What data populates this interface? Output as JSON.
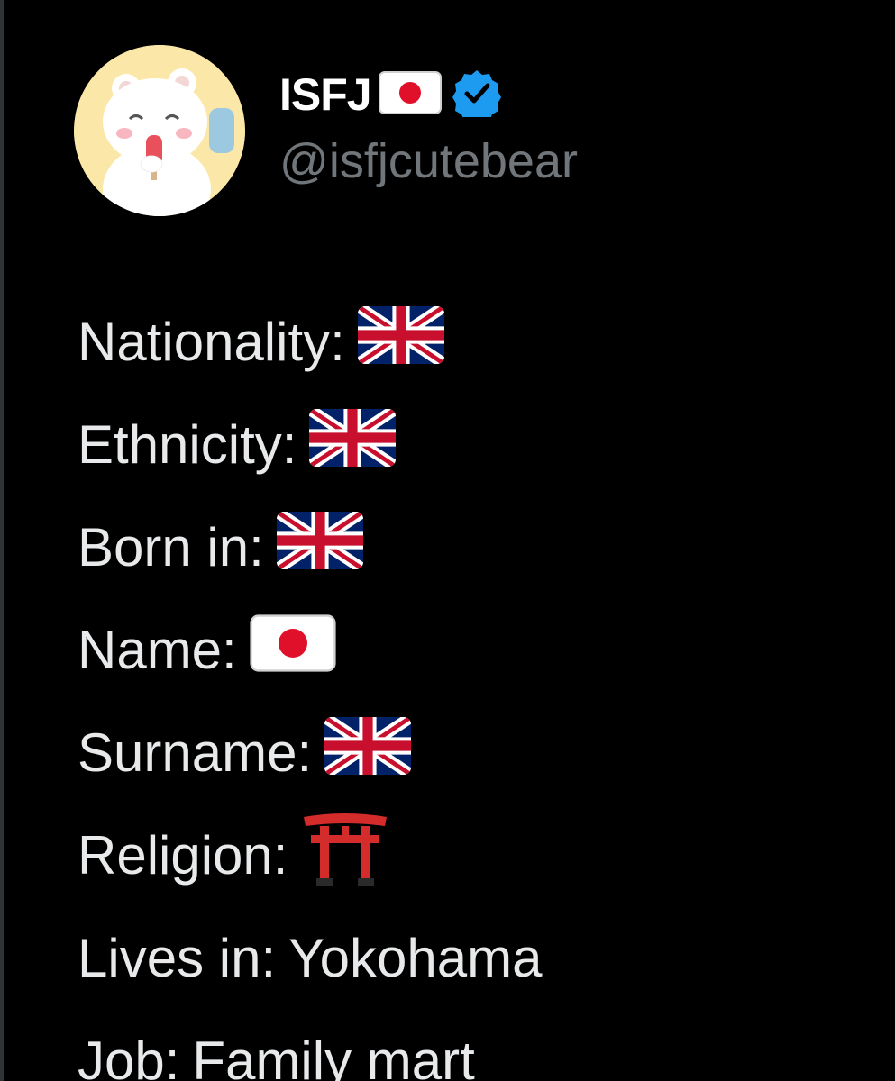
{
  "profile": {
    "display_name": "ISFJ",
    "handle": "@isfjcutebear",
    "name_flag_icon": "japan-flag-icon",
    "verified_icon": "verified-badge-icon",
    "avatar_icon": "bear-avatar"
  },
  "bio": [
    {
      "label": "Nationality:",
      "value_icon": "uk-flag-icon"
    },
    {
      "label": "Ethnicity:",
      "value_icon": "uk-flag-icon"
    },
    {
      "label": "Born in:",
      "value_icon": "uk-flag-icon"
    },
    {
      "label": "Name:",
      "value_icon": "japan-flag-icon"
    },
    {
      "label": "Surname:",
      "value_icon": "uk-flag-icon"
    },
    {
      "label": "Religion:",
      "value_icon": "torii-gate-icon"
    },
    {
      "label": "Lives in:",
      "value_text": "Yokohama"
    },
    {
      "label": "Job:",
      "value_text": "Family mart"
    }
  ],
  "colors": {
    "background": "#000000",
    "text": "#e7e9ea",
    "handle": "#71767b",
    "verified": "#1d9bf0",
    "jp_red": "#e0102a",
    "uk_blue": "#012169",
    "uk_red": "#c8102e",
    "torii_red": "#d42b2b"
  }
}
